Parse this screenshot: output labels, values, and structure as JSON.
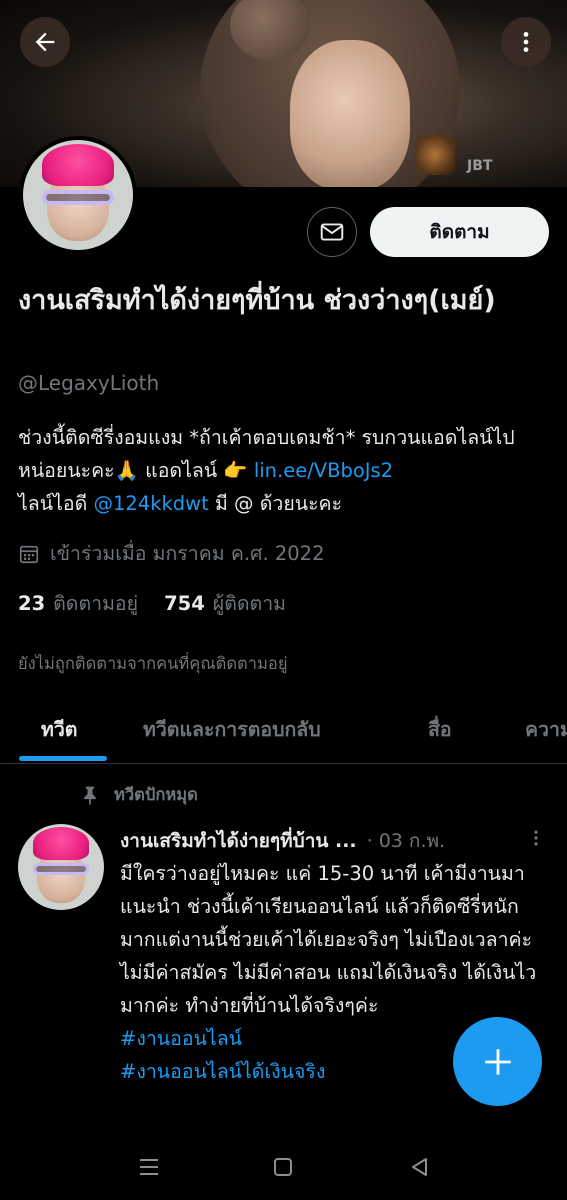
{
  "header": {
    "watermark": "JBT"
  },
  "profile": {
    "follow_label": "ติดตาม",
    "name": "งานเสริมทำได้ง่ายๆที่บ้าน ช่วงว่างๆ(เมย์)",
    "handle": "@LegaxyLioth",
    "bio_line1": "ช่วงนี้ติดซีรี่งอมแงม *ถ้าเค้าตอบเดมช้า* รบกวนแอดไลน์ไปหน่อยนะคะ🙏 แอดไลน์ 👉 ",
    "bio_link": "lin.ee/VBboJs2",
    "bio_line2_pre": "ไลน์ไอดี ",
    "bio_mention": "@124kkdwt",
    "bio_line2_post": "  มี @ ด้วยนะคะ",
    "joined": "เข้าร่วมเมื่อ มกราคม ค.ศ. 2022",
    "following_count": "23",
    "following_label": "ติดตามอยู่",
    "followers_count": "754",
    "followers_label": "ผู้ติดตาม",
    "not_followed": "ยังไม่ถูกติดตามจากคนที่คุณติดตามอยู่"
  },
  "tabs": [
    {
      "label": "ทวีต"
    },
    {
      "label": "ทวีตและการตอบกลับ"
    },
    {
      "label": "สื่อ"
    },
    {
      "label": "ความ"
    }
  ],
  "tweet": {
    "pinned_label": "ทวีตปักหมุด",
    "author": "งานเสริมทำได้ง่ายๆที่บ้าน ...",
    "date": "· 03 ก.พ.",
    "text": "มีใครว่างอยู่ไหมคะ แค่ 15-30 นาที เค้ามีงานมาแนะนำ ช่วงนี้เค้าเรียนออนไลน์ แล้วก็ติดซีรี่หนักมากแต่งานนี้ช่วยเค้าได้เยอะจริงๆ ไม่เปืองเวลาค่ะ ไม่มีค่าสมัคร ไม่มีค่าสอน แถมได้เงินจริง ได้เงินไวมากค่ะ ทำง่ายที่บ้านได้จริงๆค่ะ",
    "hashtag1": "#งานออนไลน์",
    "hashtag2": "#งานออนไลน์ได้เงินจริง"
  },
  "colors": {
    "accent": "#1d9bf0",
    "background": "#000000",
    "text": "#e7e9ea",
    "muted": "#71767b"
  }
}
